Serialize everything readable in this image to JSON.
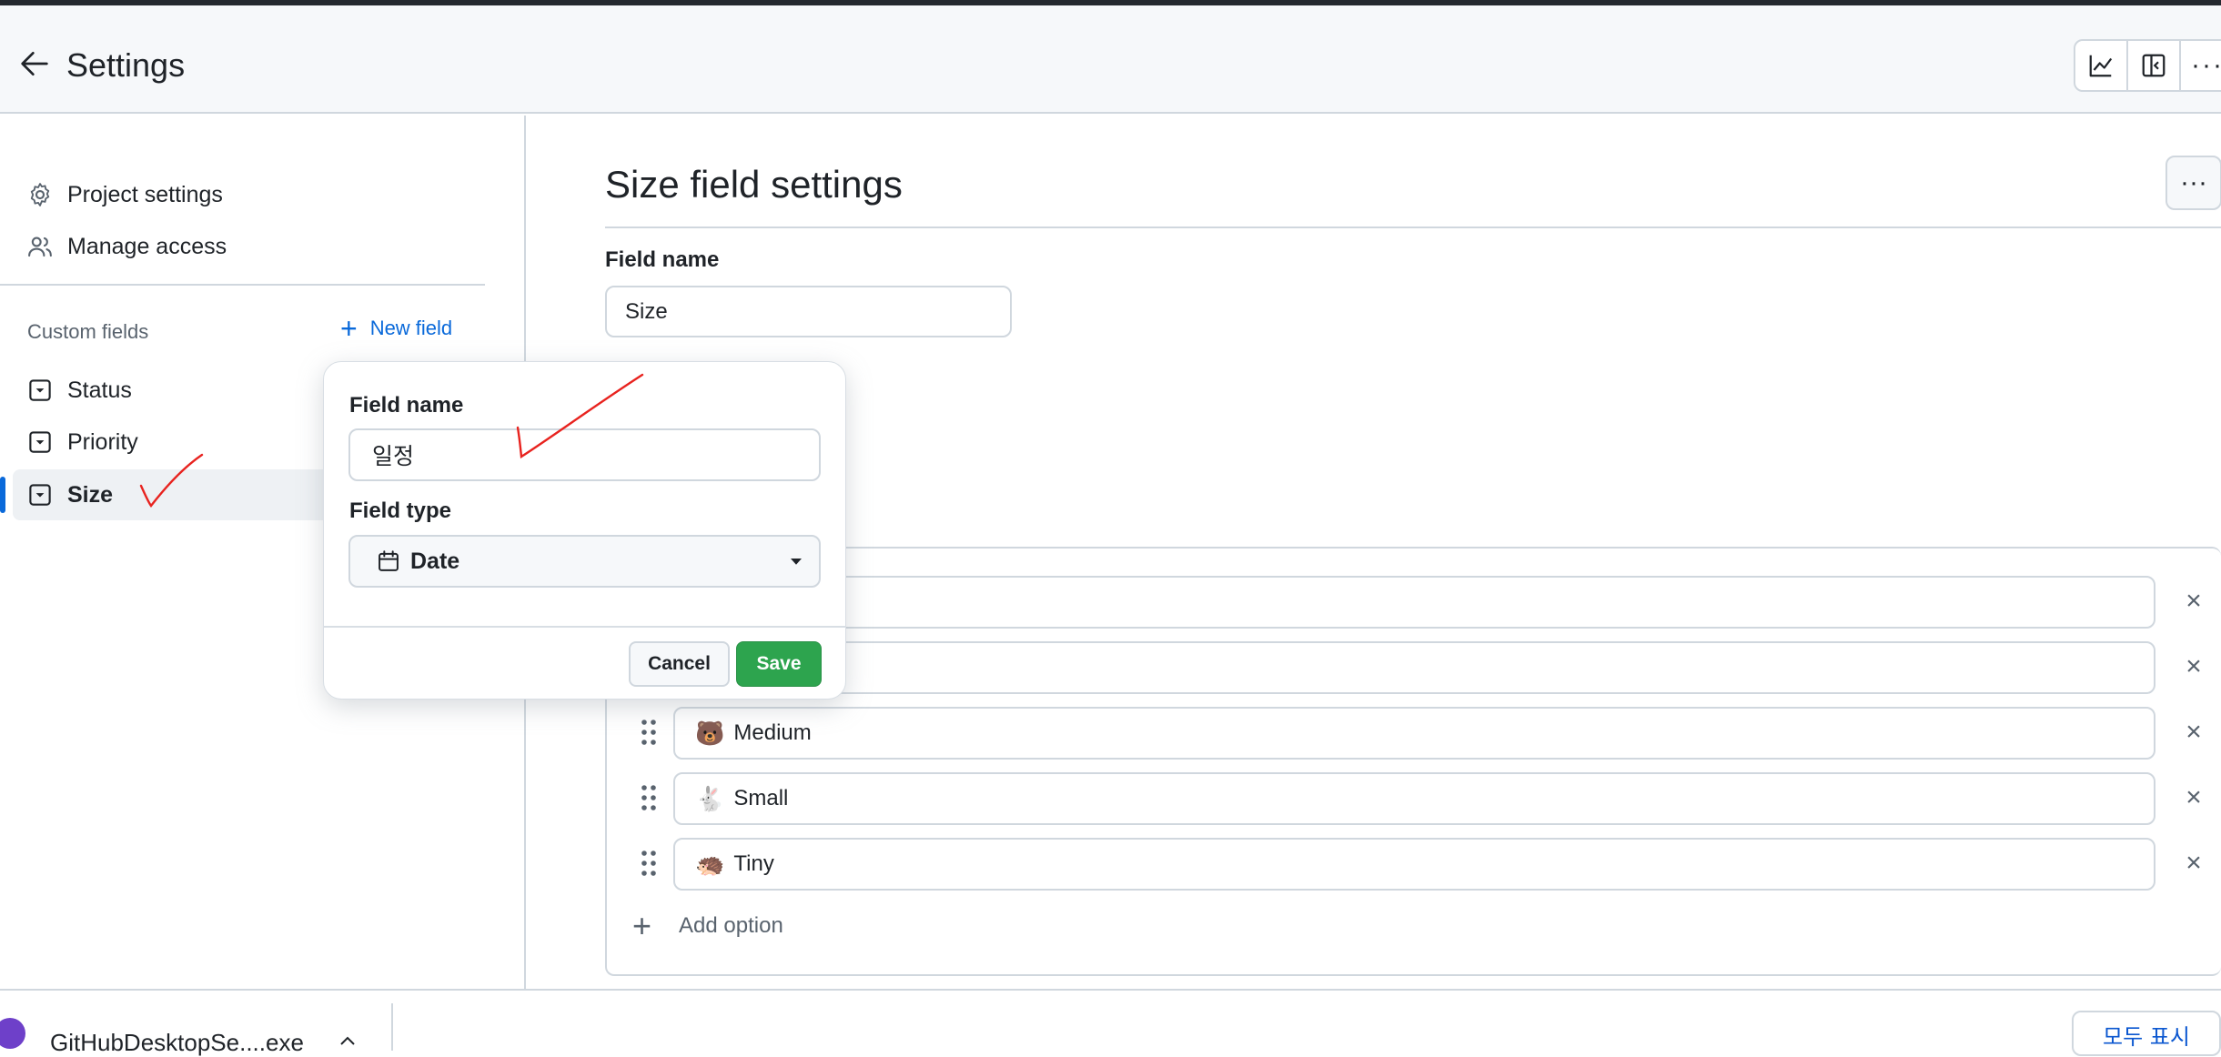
{
  "header": {
    "title": "Settings",
    "tools": [
      "insights-icon",
      "layout-icon",
      "more-icon"
    ]
  },
  "sidebar": {
    "items": [
      {
        "label": "Project settings",
        "icon": "gear-icon"
      },
      {
        "label": "Manage access",
        "icon": "people-icon"
      }
    ],
    "custom_fields_label": "Custom fields",
    "new_field_label": "New field",
    "fields": [
      {
        "label": "Status",
        "icon": "single-select-icon"
      },
      {
        "label": "Priority",
        "icon": "single-select-icon"
      },
      {
        "label": "Size",
        "icon": "single-select-icon",
        "selected": true
      }
    ]
  },
  "main": {
    "title": "Size field settings",
    "field_name_label": "Field name",
    "field_name_value": "Size",
    "options": [
      {
        "label": "",
        "emoji": ""
      },
      {
        "label": "",
        "emoji": ""
      },
      {
        "label": "Medium",
        "emoji": "🐻"
      },
      {
        "label": "Small",
        "emoji": "🐇"
      },
      {
        "label": "Tiny",
        "emoji": "🦔"
      }
    ],
    "add_option_label": "Add option"
  },
  "popover": {
    "field_name_label": "Field name",
    "field_name_value": "일정",
    "field_type_label": "Field type",
    "field_type_value": "Date",
    "cancel_label": "Cancel",
    "save_label": "Save"
  },
  "downloads": {
    "file_name": "GitHubDesktopSe....exe",
    "show_all_label": "모두 표시"
  },
  "colors": {
    "accent": "#0969da",
    "save": "#2da44e",
    "annotation": "#e8231f"
  }
}
